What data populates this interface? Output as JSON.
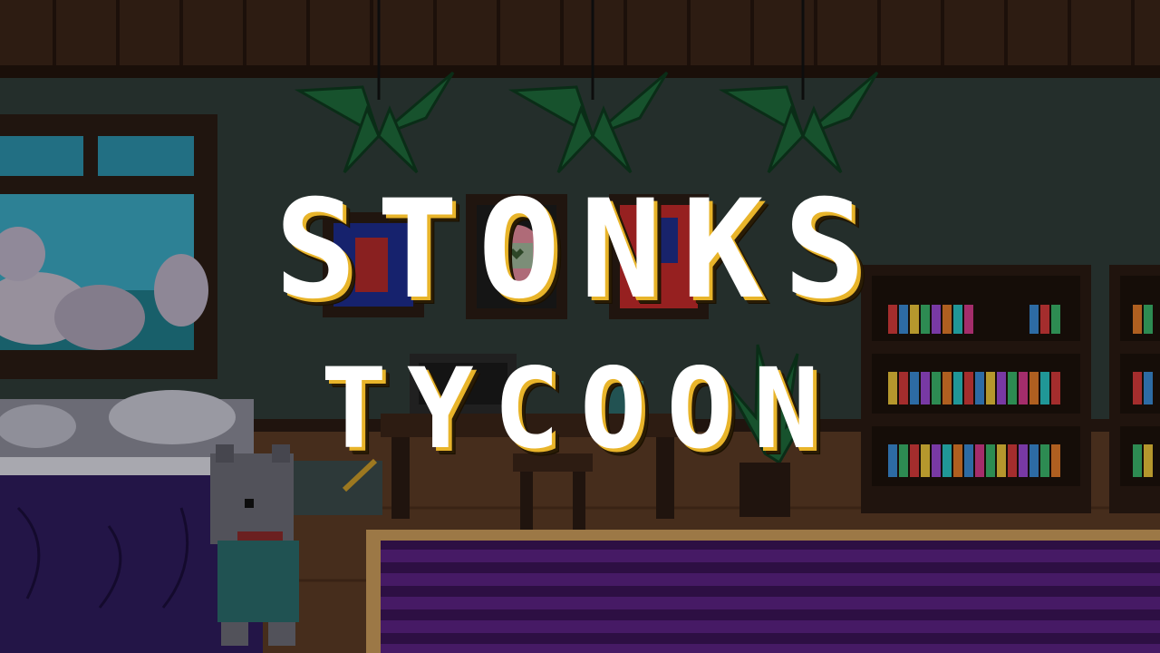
{
  "game": {
    "title_line1": "STONKS",
    "title_line2": "TYCOON"
  },
  "colors": {
    "title_text": "#ffffff",
    "title_shadow": "#e8b42a",
    "wall": "#2f3b38",
    "ceiling_wood": "#3a2418",
    "rug_purple": "#4a1a6a",
    "bed_purple": "#2e1c5c"
  },
  "icons": {
    "framed_tamagotchi": "heart-icon"
  }
}
